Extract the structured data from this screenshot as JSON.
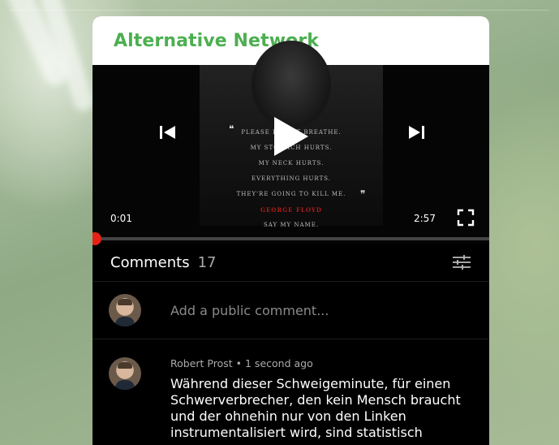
{
  "app": {
    "title": "Alternative Network",
    "brand_color": "#4caf50"
  },
  "poster_text": [
    "PLEASE I CAN'T BREATHE.",
    "MY STOMACH HURTS.",
    "MY NECK HURTS.",
    "EVERYTHING HURTS.",
    "THEY'RE GOING TO KILL ME.",
    "GEORGE FLOYD",
    "SAY MY NAME."
  ],
  "player": {
    "current_time": "0:01",
    "duration": "2:57",
    "progress_fraction": 0.0056,
    "accent_color": "#e62117",
    "icons": {
      "prev": "skip-previous-icon",
      "play": "play-icon",
      "next": "skip-next-icon",
      "fullscreen": "fullscreen-icon"
    }
  },
  "comments": {
    "title": "Comments",
    "count": "17",
    "sort_icon": "sort-icon",
    "add_placeholder": "Add a public comment...",
    "items": [
      {
        "author": "Robert Prost",
        "separator": "•",
        "time": "1 second ago",
        "text": "Während dieser Schweigeminute, für einen Schwerverbrecher, den kein Mensch braucht und der ohnehin nur von den Linken instrumentalisiert wird, sind statistisch"
      }
    ]
  }
}
